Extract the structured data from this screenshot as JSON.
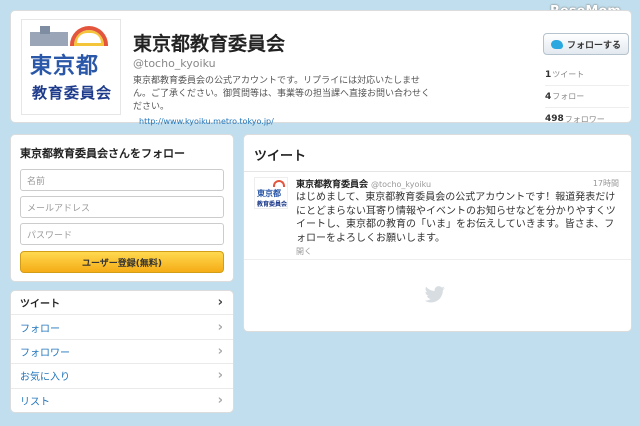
{
  "watermark": "ReseMom",
  "profile": {
    "avatar_line1": "東京都",
    "avatar_line2": "教育委員会",
    "name": "東京都教育委員会",
    "handle": "@tocho_kyoiku",
    "bio": "東京都教育委員会の公式アカウントです。リプライには対応いたしません。ご了承ください。御質問等は、事業等の担当課へ直接お問い合わせください。",
    "url": "http://www.kyoiku.metro.tokyo.jp/",
    "follow_button": "フォローする",
    "stats": [
      {
        "count": "1",
        "label": "ツイート"
      },
      {
        "count": "4",
        "label": "フォロー"
      },
      {
        "count": "498",
        "label": "フォロワー"
      }
    ]
  },
  "follow_box": {
    "title": "東京都教育委員会さんをフォロー",
    "name_placeholder": "名前",
    "email_placeholder": "メールアドレス",
    "password_placeholder": "パスワード",
    "signup_button": "ユーザー登録(無料)"
  },
  "nav": {
    "items": [
      {
        "label": "ツイート"
      },
      {
        "label": "フォロー"
      },
      {
        "label": "フォロワー"
      },
      {
        "label": "お気に入り"
      },
      {
        "label": "リスト"
      }
    ]
  },
  "tweets": {
    "title": "ツイート",
    "items": [
      {
        "name": "東京都教育委員会",
        "handle": "@tocho_kyoiku",
        "time": "17時間",
        "text": "はじめまして、東京都教育委員会の公式アカウントです！報道発表だけにとどまらない耳寄り情報やイベントのお知らせなどを分かりやすくツイートし、東京都の教育の「いま」をお伝えしていきます。皆さま、フォローをよろしくお願いします。",
        "open": "開く"
      }
    ]
  },
  "colors": {
    "background": "#c0deed",
    "link": "#2276bb",
    "signup": "#f5ac16"
  }
}
